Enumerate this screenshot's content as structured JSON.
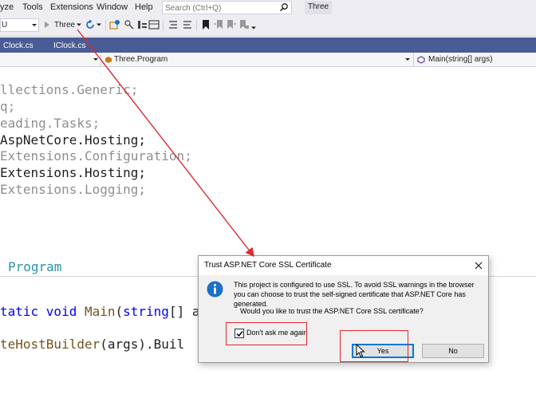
{
  "menubar": {
    "items": [
      "yze",
      "Tools",
      "Extensions",
      "Window",
      "Help"
    ],
    "search_placeholder": "Search (Ctrl+Q)",
    "solution_name": "Three"
  },
  "toolbar": {
    "config_value": "U",
    "run_target": "Three"
  },
  "tabs": [
    {
      "label": "Clock.cs"
    },
    {
      "label": "IClock.cs"
    }
  ],
  "navbar": {
    "scope": "Three.Program",
    "member": "Main(string[] args)"
  },
  "code": {
    "usings": [
      "llections.Generic;",
      "q;",
      "eading.Tasks;",
      "AspNetCore.Hosting;",
      "Extensions.Configuration;",
      "Extensions.Hosting;",
      "Extensions.Logging;"
    ],
    "class_name": "Program",
    "main_kw": "tatic void",
    "main_name": "Main",
    "main_paren": "(",
    "main_type": "string",
    "main_rest": "[] a",
    "builder_method": "teHostBuilder",
    "builder_rest": "(args).Buil"
  },
  "dialog": {
    "title": "Trust ASP.NET Core SSL Certificate",
    "message": "This project is configured to use SSL. To avoid SSL warnings in the browser you can choose to trust the self-signed certificate that ASP.NET Core has generated.",
    "question": "Would you like to trust the ASP.NET Core SSL certificate?",
    "checkbox_label": "Don't ask me again",
    "checkbox_checked": true,
    "yes_label": "Yes",
    "no_label": "No"
  },
  "colors": {
    "annotation": "#e0282f",
    "tab_well": "#4a5c95",
    "info_icon": "#1e6fc7"
  }
}
